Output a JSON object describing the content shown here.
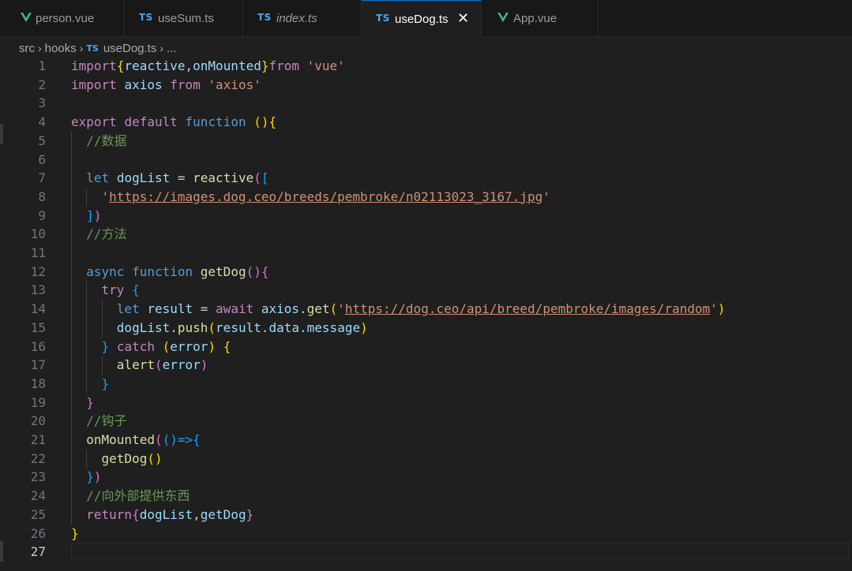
{
  "tabs": [
    {
      "icon": "V",
      "type": "vue",
      "label": "person.vue",
      "active": false
    },
    {
      "icon": "TS",
      "type": "ts",
      "label": "useSum.ts",
      "active": false
    },
    {
      "icon": "TS",
      "type": "ts",
      "label": "index.ts",
      "active": false
    },
    {
      "icon": "TS",
      "type": "ts",
      "label": "useDog.ts",
      "active": true,
      "close": "✕"
    },
    {
      "icon": "V",
      "type": "vue",
      "label": "App.vue",
      "active": false
    }
  ],
  "breadcrumb": {
    "part1": "src",
    "part2": "hooks",
    "file_icon": "TS",
    "file": "useDog.ts",
    "more": "..."
  },
  "lines": [
    {
      "n": "1",
      "t": [
        {
          "k": "k",
          "v": "import"
        },
        {
          "k": "y",
          "v": "{"
        },
        {
          "k": "v",
          "v": "reactive"
        },
        {
          "k": "p",
          "v": ","
        },
        {
          "k": "v",
          "v": "onMounted"
        },
        {
          "k": "y",
          "v": "}"
        },
        {
          "k": "k",
          "v": "from"
        },
        {
          "k": "p",
          "v": " "
        },
        {
          "k": "s",
          "v": "'vue'"
        }
      ]
    },
    {
      "n": "2",
      "t": [
        {
          "k": "k",
          "v": "import"
        },
        {
          "k": "p",
          "v": " "
        },
        {
          "k": "v",
          "v": "axios"
        },
        {
          "k": "p",
          "v": " "
        },
        {
          "k": "k",
          "v": "from"
        },
        {
          "k": "p",
          "v": " "
        },
        {
          "k": "s",
          "v": "'axios'"
        }
      ]
    },
    {
      "n": "3",
      "t": []
    },
    {
      "n": "4",
      "t": [
        {
          "k": "k",
          "v": "export"
        },
        {
          "k": "p",
          "v": " "
        },
        {
          "k": "k",
          "v": "default"
        },
        {
          "k": "p",
          "v": " "
        },
        {
          "k": "b",
          "v": "function"
        },
        {
          "k": "p",
          "v": " "
        },
        {
          "k": "y",
          "v": "(){"
        }
      ]
    },
    {
      "n": "5",
      "t": [
        {
          "k": "p",
          "v": "  "
        },
        {
          "k": "c",
          "v": "//数据"
        }
      ]
    },
    {
      "n": "6",
      "t": []
    },
    {
      "n": "7",
      "t": [
        {
          "k": "p",
          "v": "  "
        },
        {
          "k": "b",
          "v": "let"
        },
        {
          "k": "p",
          "v": " "
        },
        {
          "k": "v",
          "v": "dogList"
        },
        {
          "k": "p",
          "v": " = "
        },
        {
          "k": "f",
          "v": "reactive"
        },
        {
          "k": "m",
          "v": "("
        },
        {
          "k": "bl",
          "v": "["
        }
      ]
    },
    {
      "n": "8",
      "t": [
        {
          "k": "p",
          "v": "    "
        },
        {
          "k": "s",
          "v": "'"
        },
        {
          "k": "su",
          "v": "https://images.dog.ceo/breeds/pembroke/n02113023_3167.jpg"
        },
        {
          "k": "s",
          "v": "'"
        }
      ]
    },
    {
      "n": "9",
      "t": [
        {
          "k": "p",
          "v": "  "
        },
        {
          "k": "bl",
          "v": "]"
        },
        {
          "k": "m",
          "v": ")"
        }
      ]
    },
    {
      "n": "10",
      "t": [
        {
          "k": "p",
          "v": "  "
        },
        {
          "k": "c",
          "v": "//方法"
        }
      ]
    },
    {
      "n": "11",
      "t": []
    },
    {
      "n": "12",
      "t": [
        {
          "k": "p",
          "v": "  "
        },
        {
          "k": "b",
          "v": "async"
        },
        {
          "k": "p",
          "v": " "
        },
        {
          "k": "b",
          "v": "function"
        },
        {
          "k": "p",
          "v": " "
        },
        {
          "k": "f",
          "v": "getDog"
        },
        {
          "k": "m",
          "v": "(){"
        }
      ]
    },
    {
      "n": "13",
      "t": [
        {
          "k": "p",
          "v": "    "
        },
        {
          "k": "k",
          "v": "try"
        },
        {
          "k": "p",
          "v": " "
        },
        {
          "k": "bl",
          "v": "{"
        }
      ]
    },
    {
      "n": "14",
      "t": [
        {
          "k": "p",
          "v": "      "
        },
        {
          "k": "b",
          "v": "let"
        },
        {
          "k": "p",
          "v": " "
        },
        {
          "k": "v",
          "v": "result"
        },
        {
          "k": "p",
          "v": " = "
        },
        {
          "k": "k",
          "v": "await"
        },
        {
          "k": "p",
          "v": " "
        },
        {
          "k": "v",
          "v": "axios"
        },
        {
          "k": "p",
          "v": "."
        },
        {
          "k": "f",
          "v": "get"
        },
        {
          "k": "y",
          "v": "("
        },
        {
          "k": "s",
          "v": "'"
        },
        {
          "k": "su",
          "v": "https://dog.ceo/api/breed/pembroke/images/random"
        },
        {
          "k": "s",
          "v": "'"
        },
        {
          "k": "y",
          "v": ")"
        }
      ]
    },
    {
      "n": "15",
      "t": [
        {
          "k": "p",
          "v": "      "
        },
        {
          "k": "v",
          "v": "dogList"
        },
        {
          "k": "p",
          "v": "."
        },
        {
          "k": "f",
          "v": "push"
        },
        {
          "k": "y",
          "v": "("
        },
        {
          "k": "v",
          "v": "result"
        },
        {
          "k": "p",
          "v": "."
        },
        {
          "k": "v",
          "v": "data"
        },
        {
          "k": "p",
          "v": "."
        },
        {
          "k": "v",
          "v": "message"
        },
        {
          "k": "y",
          "v": ")"
        }
      ]
    },
    {
      "n": "16",
      "t": [
        {
          "k": "p",
          "v": "    "
        },
        {
          "k": "bl",
          "v": "}"
        },
        {
          "k": "p",
          "v": " "
        },
        {
          "k": "k",
          "v": "catch"
        },
        {
          "k": "p",
          "v": " "
        },
        {
          "k": "y",
          "v": "("
        },
        {
          "k": "v",
          "v": "error"
        },
        {
          "k": "y",
          "v": ")"
        },
        {
          "k": "p",
          "v": " "
        },
        {
          "k": "y",
          "v": "{"
        }
      ]
    },
    {
      "n": "17",
      "t": [
        {
          "k": "p",
          "v": "      "
        },
        {
          "k": "f",
          "v": "alert"
        },
        {
          "k": "m",
          "v": "("
        },
        {
          "k": "v",
          "v": "error"
        },
        {
          "k": "m",
          "v": ")"
        }
      ]
    },
    {
      "n": "18",
      "t": [
        {
          "k": "p",
          "v": "    "
        },
        {
          "k": "bl",
          "v": "}"
        }
      ]
    },
    {
      "n": "19",
      "t": [
        {
          "k": "p",
          "v": "  "
        },
        {
          "k": "m",
          "v": "}"
        }
      ]
    },
    {
      "n": "20",
      "t": [
        {
          "k": "p",
          "v": "  "
        },
        {
          "k": "c",
          "v": "//钩子"
        }
      ]
    },
    {
      "n": "21",
      "t": [
        {
          "k": "p",
          "v": "  "
        },
        {
          "k": "f",
          "v": "onMounted"
        },
        {
          "k": "m",
          "v": "("
        },
        {
          "k": "bl",
          "v": "()=>{"
        }
      ]
    },
    {
      "n": "22",
      "t": [
        {
          "k": "p",
          "v": "    "
        },
        {
          "k": "f",
          "v": "getDog"
        },
        {
          "k": "y",
          "v": "()"
        }
      ]
    },
    {
      "n": "23",
      "t": [
        {
          "k": "p",
          "v": "  "
        },
        {
          "k": "bl",
          "v": "}"
        },
        {
          "k": "m",
          "v": ")"
        }
      ]
    },
    {
      "n": "24",
      "t": [
        {
          "k": "p",
          "v": "  "
        },
        {
          "k": "c",
          "v": "//向外部提供东西"
        }
      ]
    },
    {
      "n": "25",
      "t": [
        {
          "k": "p",
          "v": "  "
        },
        {
          "k": "k",
          "v": "return"
        },
        {
          "k": "m",
          "v": "{"
        },
        {
          "k": "v",
          "v": "dogList"
        },
        {
          "k": "p",
          "v": ","
        },
        {
          "k": "v",
          "v": "getDog"
        },
        {
          "k": "m",
          "v": "}"
        }
      ]
    },
    {
      "n": "26",
      "t": [
        {
          "k": "y",
          "v": "}"
        }
      ]
    },
    {
      "n": "27",
      "t": [],
      "current": true
    }
  ]
}
